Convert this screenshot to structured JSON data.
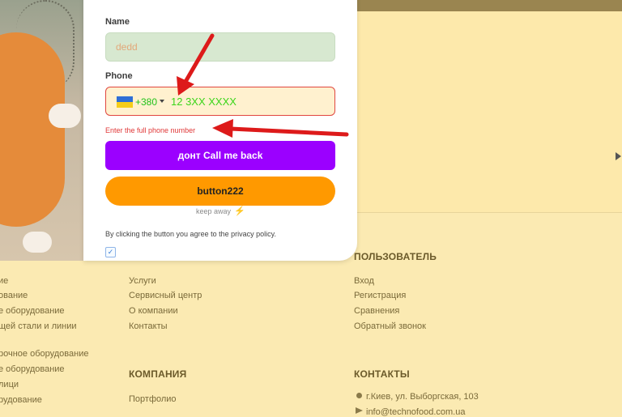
{
  "form": {
    "name_label": "Name",
    "name_value": "dedd",
    "phone_label": "Phone",
    "dial_code": "+380",
    "phone_value": "12 3XX XXXX",
    "error_text": "Enter the full phone number",
    "callback_button": "донт Call me back",
    "button222": "button222",
    "keep_away": "keep away",
    "privacy_text": "By clicking the button you agree to the privacy policy."
  },
  "footer": {
    "left_links_1": [
      "ие",
      "ование",
      "е оборудование",
      "щей стали и линии"
    ],
    "left_links_2": [
      "рочное оборудование",
      "е оборудование",
      "лици",
      "рудование"
    ],
    "mid_links": [
      "Услуги",
      "Сервисный центр",
      "О компании",
      "Контакты"
    ],
    "company_heading": "КОМПАНИЯ",
    "company_links": [
      "Портфолио"
    ],
    "user_heading": "ПОЛЬЗОВАТЕЛЬ",
    "user_links": [
      "Вход",
      "Регистрация",
      "Сравнения",
      "Обратный звонок"
    ],
    "contacts_heading": "КОНТАКТЫ",
    "address": "г.Киев, ул. Выборгская, 103",
    "email_partial": "info@technofood.com.ua"
  },
  "colors": {
    "callback": "#9b00ff",
    "button222": "#ff9900",
    "error": "#e03838",
    "phone_text": "#3bd51a"
  },
  "icons": [
    "ukraine-flag-icon",
    "chevron-down-icon",
    "lightning-icon",
    "checkmark-icon",
    "map-pin-icon",
    "paper-plane-icon",
    "red-arrow-icon"
  ]
}
